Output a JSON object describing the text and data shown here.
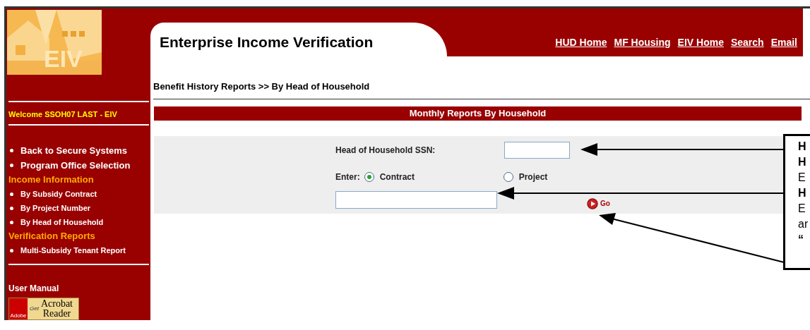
{
  "sidebar": {
    "logo_text": "EIV",
    "welcome": "Welcome SSOH07 LAST - EIV",
    "items": [
      {
        "kind": "link",
        "label": "Back to Secure Systems"
      },
      {
        "kind": "link",
        "label": "Program Office Selection"
      },
      {
        "kind": "heading",
        "label": "Income Information"
      },
      {
        "kind": "sublink",
        "label": "By Subsidy Contract"
      },
      {
        "kind": "sublink",
        "label": "By Project Number"
      },
      {
        "kind": "sublink",
        "label": "By Head of Household"
      },
      {
        "kind": "heading",
        "label": "Verification Reports"
      },
      {
        "kind": "sublink",
        "label": "Multi-Subsidy Tenant Report"
      }
    ],
    "manual_heading": "User Manual",
    "reader_badge": {
      "small": "Get",
      "line1": "Acrobat",
      "line2": "Reader",
      "brand": "Adobe"
    }
  },
  "header": {
    "title": "Enterprise Income Verification",
    "links": [
      "HUD Home",
      "MF Housing",
      "EIV Home",
      "Search",
      "Email"
    ]
  },
  "breadcrumb": "Benefit History Reports >> By Head of Household",
  "section_title": "Monthly Reports By Household",
  "form": {
    "ssn_label": "Head of Household SSN:",
    "enter_label": "Enter:",
    "options": [
      {
        "label": "Contract",
        "selected": true
      },
      {
        "label": "Project",
        "selected": false
      }
    ],
    "go_label": "Go"
  },
  "callout": {
    "lines": [
      {
        "text": "H",
        "bold": true
      },
      {
        "text": "H",
        "bold": true
      },
      {
        "text": "E",
        "bold": false
      },
      {
        "text": "H",
        "bold": true
      },
      {
        "text": "E",
        "bold": false
      },
      {
        "text": "ar",
        "bold": false
      },
      {
        "text": "“",
        "bold": true
      }
    ]
  }
}
